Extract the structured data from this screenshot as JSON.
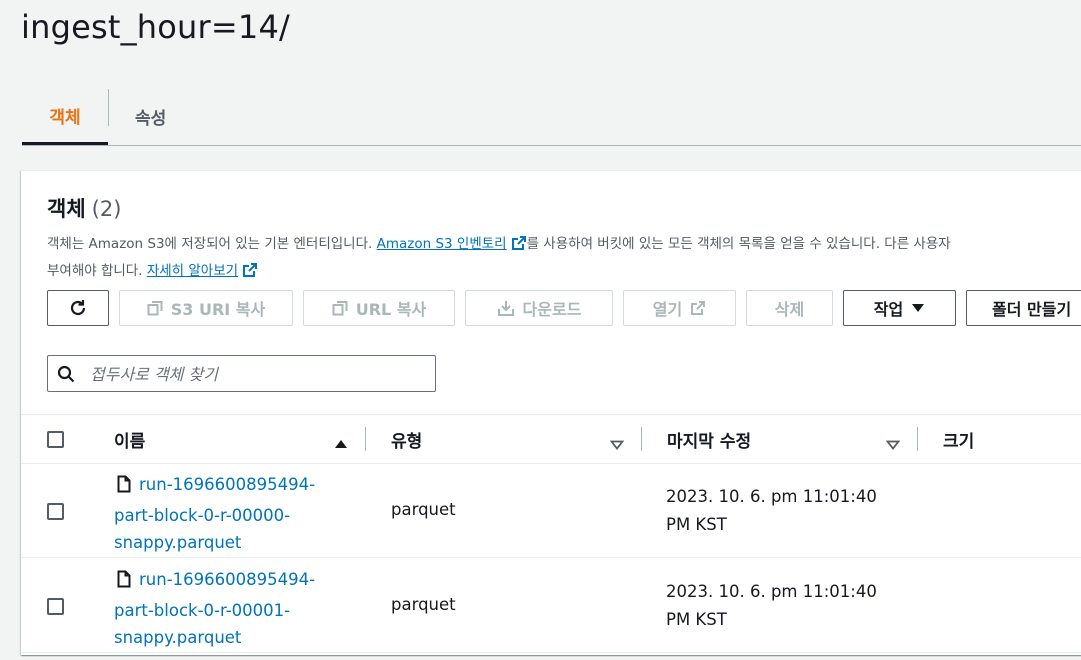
{
  "page": {
    "title": "ingest_hour=14/"
  },
  "tabs": [
    {
      "label": "객체",
      "active": true
    },
    {
      "label": "속성",
      "active": false
    }
  ],
  "panel": {
    "title": "객체",
    "count": "(2)",
    "description": {
      "part1": "객체는 Amazon S3에 저장되어 있는 기본 엔터티입니다. ",
      "link1": "Amazon S3 인벤토리",
      "part2": "를 사용하여 버킷에 있는 모든 객체의 목록을 얻을 수 있습니다. 다른 사용자",
      "part3": "부여해야 합니다. ",
      "link2": "자세히 알아보기"
    }
  },
  "toolbar": {
    "refresh_label": "",
    "copy_s3_uri": "S3 URI 복사",
    "copy_url": "URL 복사",
    "download": "다운로드",
    "open": "열기",
    "delete": "삭제",
    "actions": "작업",
    "create_folder": "폴더 만들기"
  },
  "search": {
    "placeholder": "접두사로 객체 찾기",
    "value": ""
  },
  "table": {
    "columns": {
      "name": "이름",
      "type": "유형",
      "modified": "마지막 수정",
      "size": "크기"
    },
    "rows": [
      {
        "name_lines": [
          "run-1696600895494-",
          "part-block-0-r-00000-",
          "snappy.parquet"
        ],
        "type": "parquet",
        "modified_lines": [
          "2023. 10. 6. pm 11:01:40",
          "PM KST"
        ],
        "size": ""
      },
      {
        "name_lines": [
          "run-1696600895494-",
          "part-block-0-r-00001-",
          "snappy.parquet"
        ],
        "type": "parquet",
        "modified_lines": [
          "2023. 10. 6. pm 11:01:40",
          "PM KST"
        ],
        "size": ""
      }
    ]
  },
  "colors": {
    "accent": "#ec7211",
    "link": "#0073bb",
    "text": "#16191f",
    "muted": "#545b64"
  }
}
